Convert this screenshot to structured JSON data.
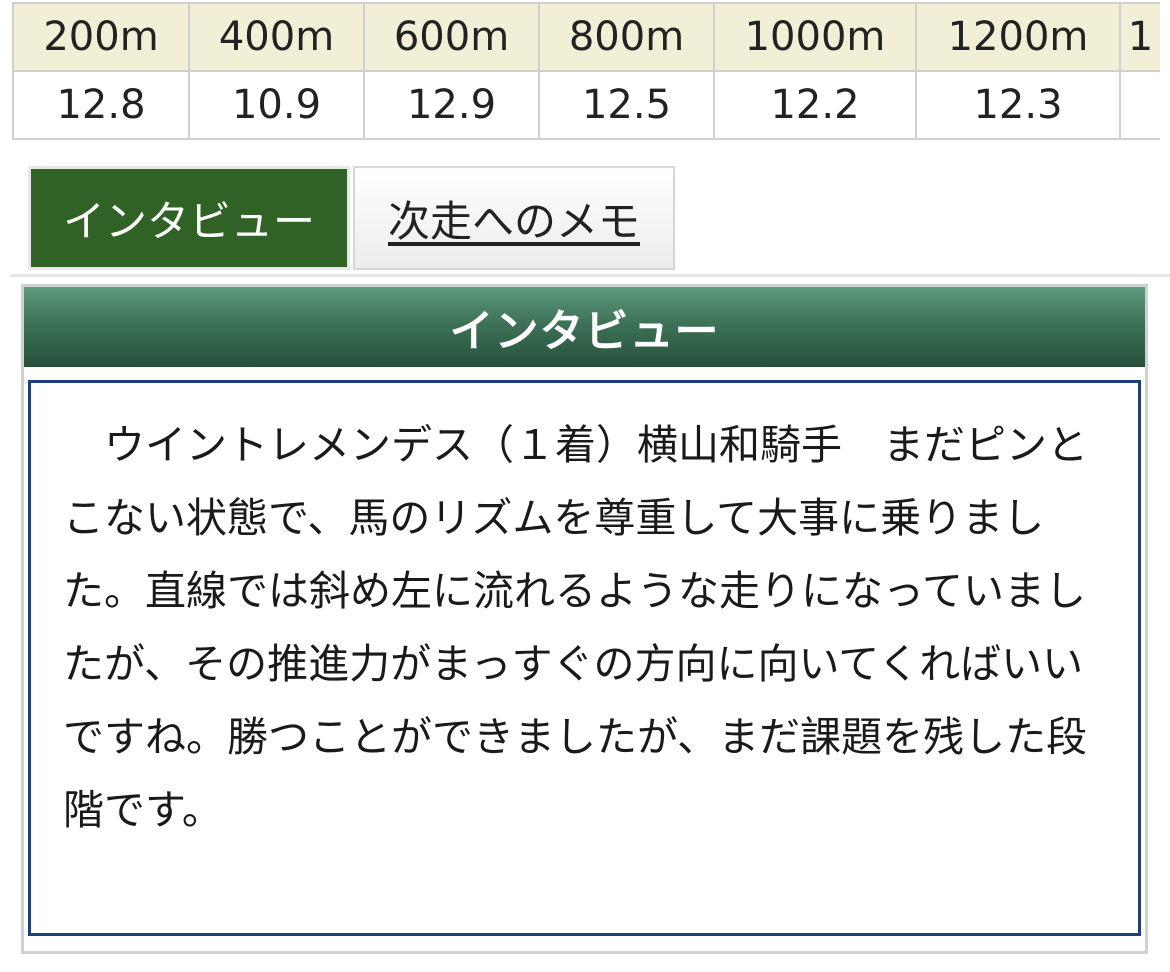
{
  "lap_table": {
    "distances": [
      "200m",
      "400m",
      "600m",
      "800m",
      "1000m",
      "1200m",
      "1"
    ],
    "times": [
      "12.8",
      "10.9",
      "12.9",
      "12.5",
      "12.2",
      "12.3",
      ""
    ]
  },
  "tabs": [
    {
      "label": "インタビュー",
      "active": true
    },
    {
      "label": "次走へのメモ",
      "active": false
    }
  ],
  "interview": {
    "header": "インタビュー",
    "body": "ウイントレメンデス（１着）横山和騎手　まだピンとこない状態で、馬のリズムを尊重して大事に乗りました。直線では斜め左に流れるような走りになっていましたが、その推進力がまっすぐの方向に向いてくればいいですね。勝つことができましたが、まだ課題を残した段階です。"
  },
  "colors": {
    "table_header_bg": "#f1efd6",
    "active_tab_bg": "#2f6224",
    "panel_header_bg": "#3e7258",
    "body_border": "#1f3f7a"
  }
}
